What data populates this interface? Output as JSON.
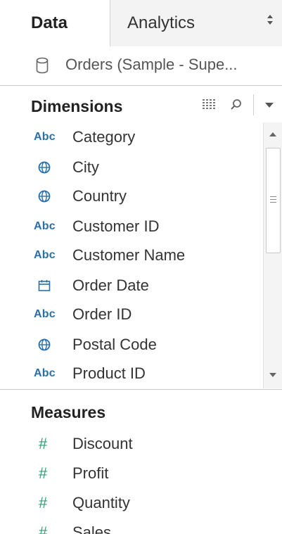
{
  "tabs": {
    "data_label": "Data",
    "analytics_label": "Analytics"
  },
  "datasource": {
    "name": "Orders (Sample - Supe..."
  },
  "dimensions": {
    "title": "Dimensions",
    "fields": [
      {
        "icon": "abc",
        "label": "Category"
      },
      {
        "icon": "globe",
        "label": "City"
      },
      {
        "icon": "globe",
        "label": "Country"
      },
      {
        "icon": "abc",
        "label": "Customer ID"
      },
      {
        "icon": "abc",
        "label": "Customer Name"
      },
      {
        "icon": "calendar",
        "label": "Order Date"
      },
      {
        "icon": "abc",
        "label": "Order ID"
      },
      {
        "icon": "globe",
        "label": "Postal Code"
      },
      {
        "icon": "abc",
        "label": "Product ID"
      }
    ],
    "abc_icon_text": "Abc"
  },
  "measures": {
    "title": "Measures",
    "hash_icon_text": "#",
    "fields": [
      {
        "label": "Discount"
      },
      {
        "label": "Profit"
      },
      {
        "label": "Quantity"
      },
      {
        "label": "Sales"
      }
    ]
  },
  "colors": {
    "dimension_icon": "#2b6fa8",
    "measure_icon": "#2e9e74"
  }
}
